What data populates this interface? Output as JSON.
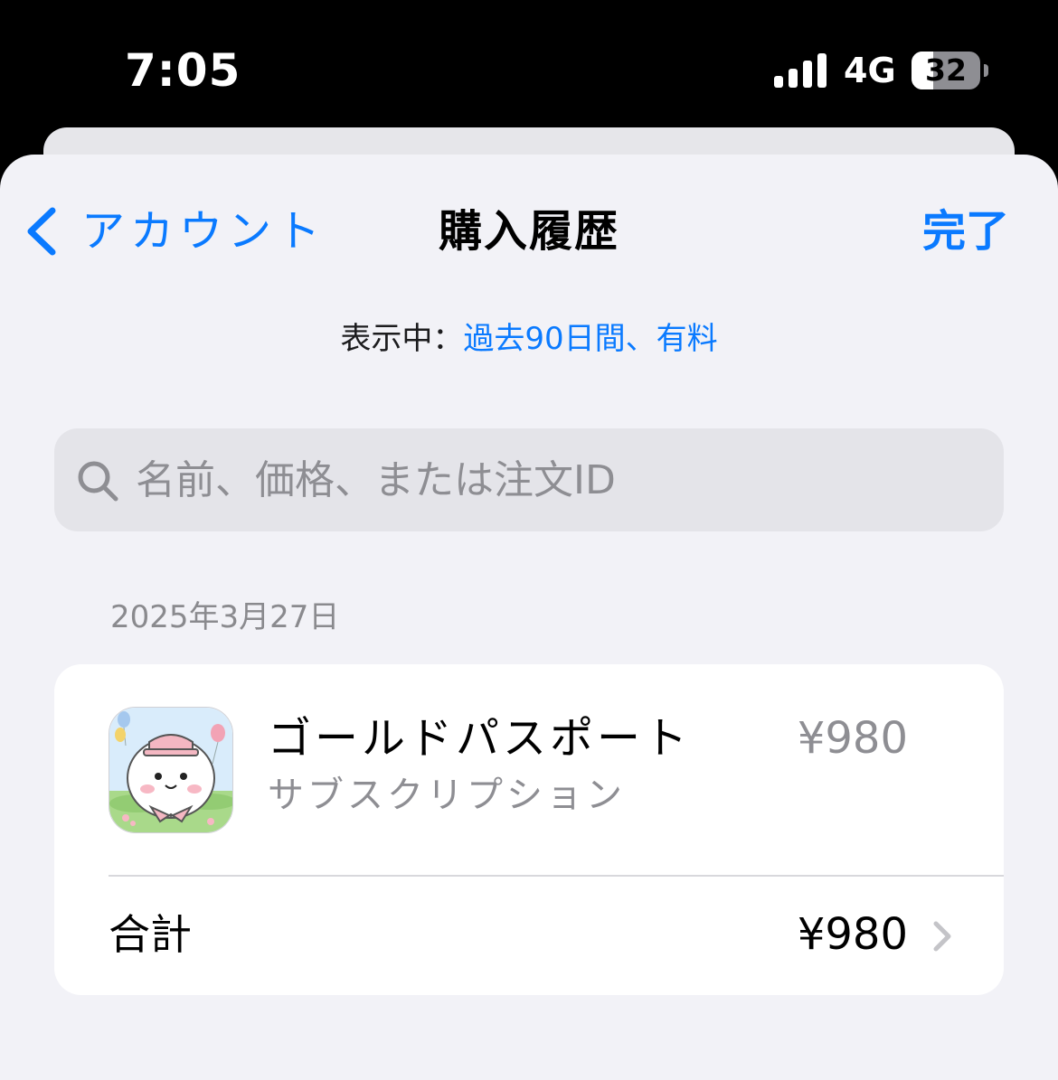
{
  "status_bar": {
    "time": "7:05",
    "network": "4G",
    "battery_level": "32",
    "battery_fraction": 0.32,
    "signal_icon": "cellular-signal-icon"
  },
  "nav": {
    "back_label": "アカウント",
    "back_icon": "chevron-left-icon",
    "title": "購入履歴",
    "done_label": "完了"
  },
  "filter": {
    "prefix": "表示中：",
    "value": "過去90日間、有料"
  },
  "search": {
    "placeholder": "名前、価格、または注文ID",
    "value": "",
    "icon": "search-icon"
  },
  "sections": [
    {
      "date": "2025年3月27日",
      "purchases": [
        {
          "title": "ゴールドパスポート",
          "subtitle": "サブスクリプション",
          "price": "¥980",
          "icon": "app-icon"
        }
      ],
      "total_label": "合計",
      "total_value": "¥980"
    }
  ],
  "colors": {
    "accent": "#0a7aff",
    "sheet_background": "#f2f2f7",
    "secondary_text": "#8e8e93"
  }
}
